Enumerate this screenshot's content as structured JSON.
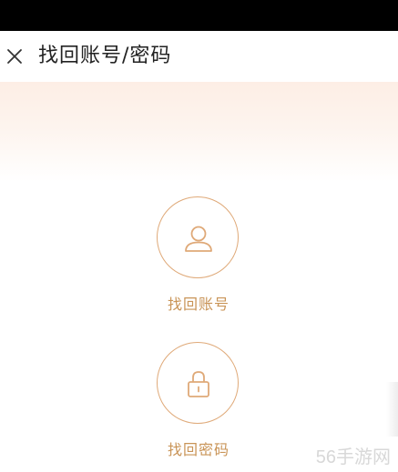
{
  "header": {
    "title": "找回账号/密码",
    "close_icon": "close-icon"
  },
  "options": [
    {
      "label": "找回账号",
      "icon": "user-icon"
    },
    {
      "label": "找回密码",
      "icon": "lock-icon"
    }
  ],
  "watermark": {
    "text": "56手游网"
  },
  "colors": {
    "accent": "#dfa978",
    "label": "#c99457",
    "gradient_top": "#fdeee5",
    "status_bar": "#000000"
  }
}
